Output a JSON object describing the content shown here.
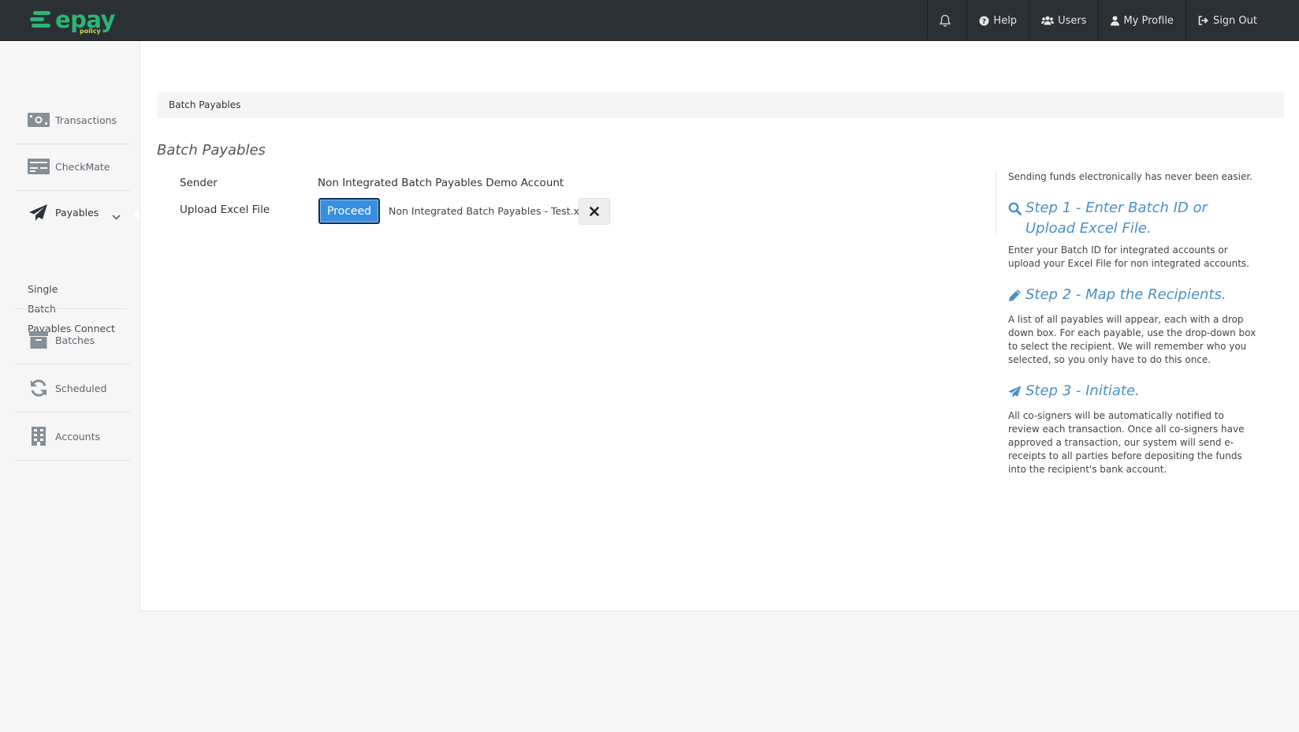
{
  "brand": {
    "name": "epay",
    "tagline": "policy",
    "color": "#2bb673"
  },
  "header": {
    "notifications_icon": "bell-icon",
    "help": "Help",
    "users": "Users",
    "profile": "My Profile",
    "signout": "Sign Out"
  },
  "sidebar": {
    "items": [
      {
        "label": "Transactions",
        "icon": "money-icon"
      },
      {
        "label": "CheckMate",
        "icon": "cheque-icon"
      },
      {
        "label": "Payables",
        "icon": "paper-plane-icon"
      },
      {
        "label": "Batches",
        "icon": "archive-box-icon"
      },
      {
        "label": "Scheduled",
        "icon": "refresh-icon"
      },
      {
        "label": "Accounts",
        "icon": "building-icon"
      }
    ],
    "payables_sub": [
      "Single",
      "Batch",
      "Payables Connect"
    ]
  },
  "main": {
    "breadcrumb": "Batch Payables",
    "title": "Batch Payables",
    "form": {
      "sender_label": "Sender",
      "sender_value": "Non Integrated Batch Payables Demo Account",
      "upload_label": "Upload Excel File",
      "proceed_label": "Proceed",
      "file_name": "Non Integrated Batch Payables - Test.xlsx"
    }
  },
  "help": {
    "intro": "Sending funds electronically has never been easier.",
    "steps": [
      {
        "title": "Step 1 - Enter Batch ID or Upload Excel File.",
        "icon": "search-icon",
        "text": "Enter your Batch ID for integrated accounts or upload your Excel File for non integrated accounts."
      },
      {
        "title": "Step 2 - Map the Recipients.",
        "icon": "pencil-icon",
        "text": "A list of all payables will appear, each with a drop down box. For each payable, use the drop-down box to select the recipient. We will remember who you selected, so you only have to do this once."
      },
      {
        "title": "Step 3 - Initiate.",
        "icon": "paper-plane-icon",
        "text": "All co-signers will be automatically notified to review each transaction. Once all co-signers have approved a transaction, our system will send e-receipts to all parties before depositing the funds into the recipient's bank account."
      }
    ]
  },
  "colors": {
    "topbar": "#2b3035",
    "primary_button": "#3a8ee0",
    "step_title": "#4a90c8"
  }
}
